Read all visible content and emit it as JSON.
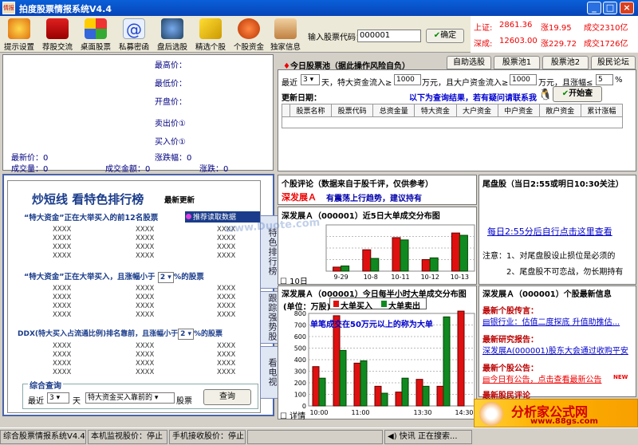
{
  "window": {
    "title": "拍度股票情报系统V4.4",
    "icon_text": "情报"
  },
  "toolbar": {
    "buttons": [
      "提示设置",
      "荐股交流",
      "桌面股票",
      "私募密函",
      "盘后选股",
      "精选个股",
      "个股资金",
      "独家信息"
    ],
    "code_label": "输入股票代码：",
    "code_value": "000001",
    "ok_label": "确定"
  },
  "index": {
    "sh_label": "上证:",
    "sh_value": "2861.36",
    "sh_change": "涨19.95",
    "sh_amount": "成交2310亿",
    "sz_label": "深成:",
    "sz_value": "12603.00",
    "sz_change": "涨229.72",
    "sz_amount": "成交1726亿"
  },
  "quote": {
    "high": "最高价：",
    "low": "最低价：",
    "open": "开盘价：",
    "sell1": "卖出价①",
    "buy1": "买入价①",
    "latest": "最新价：0",
    "change": "涨跌幅：0",
    "volume": "成交量：0",
    "turnover": "成交金额：0",
    "diff": "涨跌：0"
  },
  "pool": {
    "title": "今日股票池（据此操作风险自负）",
    "tabs": [
      "自助选股",
      "股票池1",
      "股票池2",
      "股民论坛"
    ],
    "recent": "最近",
    "days": "3",
    "cond1": "天，特大资金流入≥",
    "v1": "1000",
    "cond2": "万元，且大户资金流入≥",
    "v2": "1000",
    "cond3": "万元，且涨幅≤",
    "v3": "5",
    "pct": "%",
    "update": "更新日期：",
    "hint": "以下为查询结果，若有疑问请联系我",
    "start": "开始查",
    "columns": [
      "股票名称",
      "股票代码",
      "总资金量",
      "特大资金",
      "大户资金",
      "中户资金",
      "散户资金",
      "累计涨幅"
    ]
  },
  "hot": {
    "title": "炒短线  看特色排行榜",
    "subtitle": "最新更新",
    "sec1": "“特大资金”正在大举买入的前12名股票",
    "sec1_badge": "推荐读取数据",
    "sec2a": "“特大资金”正在大举买入，且涨幅小于",
    "sec2_sel": "2",
    "sec2b": "%的股票",
    "sec3a": "DDX(特大买入占流通比例)排名靠前，且涨幅小于",
    "sec3_sel": "2",
    "sec3b": "%的股票",
    "cell": "XXXX",
    "query_title": "综合查询",
    "q_recent": "最近",
    "q_days": "3",
    "q_day_unit": "天",
    "q_type": "特大资金买入靠前的",
    "q_stock": "股票",
    "q_btn": "查询"
  },
  "vtabs": [
    "特色排行榜",
    "跟踪强势股",
    "看电视"
  ],
  "comment": {
    "title": "个股评论（数据来自于股千评，仅供参考）",
    "stock": "深发展Ａ",
    "text": "有震荡上行趋势，建议持有"
  },
  "tail": {
    "title": "尾盘股（当日2:55或明日10:30关注）",
    "link": "每日2:55分后自行点击这里查看",
    "note1": "注意：1、对尾盘股设止损位是必须的",
    "note2": "2、尾盘股不可恋战，勿长期持有"
  },
  "chart1": {
    "title": "深发展Ａ（000001）近5日大单成交分布图",
    "check": "10日"
  },
  "chart2": {
    "title": "深发展Ａ（000001）今日每半小时大单成交分布图",
    "unit": "(单位：万股)",
    "legend_buy": "大单买入",
    "legend_sell": "大单卖出",
    "note": "单笔成交在50万元以上的称为大单",
    "check": "详情"
  },
  "info": {
    "title": "深发展Ａ（000001）个股最新信息",
    "s1": "最新个股传言：",
    "s1_item": "银行业：估值二度探底 升值助推估...",
    "s2": "最新研究报告：",
    "s2_item": "深发展A(000001)股东大会通过收购平安",
    "s3": "最新个股公告：",
    "s3_item": "今日有公告，点击查看最新公告",
    "new": "NEW",
    "s4": "最新股民评论"
  },
  "status": {
    "s1": "综合股票情报系统V4.4",
    "s2": "本机监视股价：停止",
    "s3": "手机接收股价：停止",
    "s4": "快讯 正在搜索...",
    "watermark": "分析家公式网",
    "watermark_url": "www.88gs.com",
    "chart_wm": "www.Duote.com"
  },
  "colors": {
    "buy": "#e01010",
    "sell": "#108a20"
  },
  "chart_data": [
    {
      "type": "bar",
      "title": "深发展Ａ（000001）近5日大单成交分布图",
      "categories": [
        "9-29",
        "10-8",
        "10-11",
        "10-12",
        "10-13"
      ],
      "series": [
        {
          "name": "大单买入",
          "values": [
            3.5,
            18.5,
            29,
            10,
            33
          ]
        },
        {
          "name": "大单卖出",
          "values": [
            4.5,
            11,
            27,
            11.5,
            31
          ]
        }
      ],
      "ylim": [
        0,
        40
      ]
    },
    {
      "type": "bar",
      "title": "深发展Ａ（000001）今日每半小时大单成交分布图",
      "ylabel": "(单位：万股)",
      "categories": [
        "10:00",
        "10:30",
        "11:00",
        "11:30",
        "13:00",
        "13:30",
        "14:00",
        "14:30"
      ],
      "tick_labels": [
        "10:00",
        "11:00",
        "13:30",
        "14:30"
      ],
      "series": [
        {
          "name": "大单买入",
          "values": [
            340,
            780,
            370,
            170,
            120,
            230,
            170,
            820
          ]
        },
        {
          "name": "大单卖出",
          "values": [
            240,
            480,
            390,
            110,
            240,
            170,
            770
          ]
        }
      ],
      "ylim": [
        0,
        800
      ],
      "yticks": [
        0,
        100,
        200,
        300,
        400,
        500,
        600,
        700,
        800
      ]
    }
  ]
}
